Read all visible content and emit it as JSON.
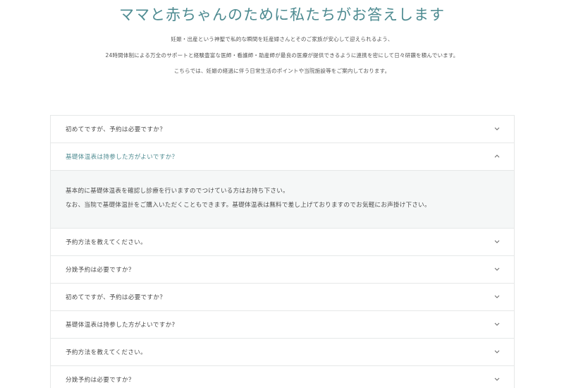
{
  "header": {
    "title": "ママと赤ちゃんのために私たちがお答えします",
    "intro_lines": [
      "妊娠・出産という神聖で私的な瞬間を妊産婦さんとそのご家族が安心して迎えられるよう、",
      "24時間体制による万全のサポートと経験豊富な医師・看護師・助産師が最良の医療が提供できるように連携を密にして日々研鑽を積んでいます。",
      "こちらでは、妊娠の経過に伴う日常生活のポイントや当院施設等をご案内しております。"
    ]
  },
  "faq": {
    "items": [
      {
        "question": "初めてですが、予約は必要ですか？",
        "expanded": false
      },
      {
        "question": "基礎体温表は持参した方がよいですか？",
        "expanded": true,
        "answer_lines": [
          "基本的に基礎体温表を確認し診療を行いますのでつけている方はお持ち下さい。",
          "なお、当院で基礎体温計をご購入いただくこともできます。基礎体温表は無料で差し上げておりますのでお気軽にお声掛け下さい。"
        ]
      },
      {
        "question": "予約方法を教えてください。",
        "expanded": false
      },
      {
        "question": "分娩予約は必要ですか？",
        "expanded": false
      },
      {
        "question": "初めてですが、予約は必要ですか？",
        "expanded": false
      },
      {
        "question": "基礎体温表は持参した方がよいですか?",
        "expanded": false
      },
      {
        "question": "予約方法を教えてください。",
        "expanded": false
      },
      {
        "question": "分娩予約は必要ですか？",
        "expanded": false
      }
    ]
  },
  "icons": {
    "collapsed": "chevron-down-icon",
    "expanded": "chevron-up-icon"
  },
  "colors": {
    "accent": "#4e8b91",
    "text": "#4a4a4a",
    "border": "#e6e8e8",
    "answer_background": "#f5f7f7"
  }
}
